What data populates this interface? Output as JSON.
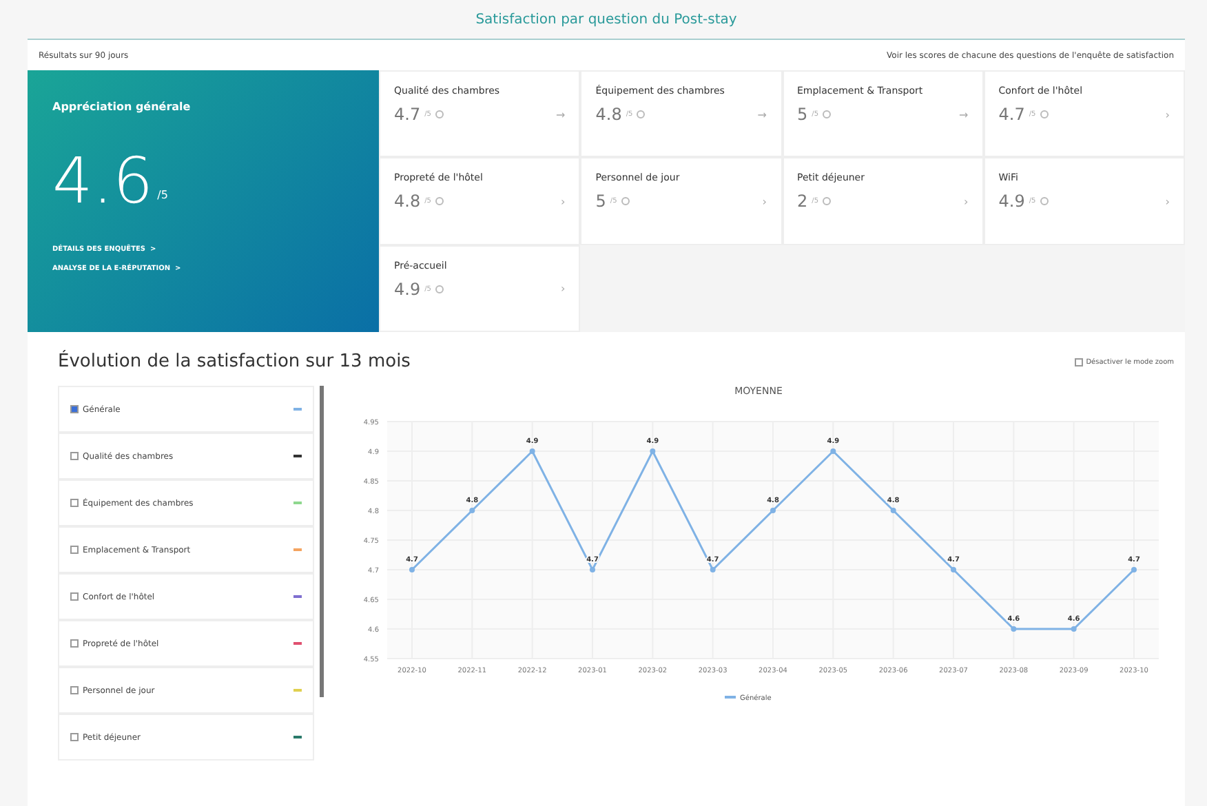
{
  "header": {
    "title": "Satisfaction par question du Post-stay",
    "period": "Résultats sur 90 jours",
    "link": "Voir les scores de chacune des questions de l'enquête de satisfaction"
  },
  "overall": {
    "title": "Appréciation générale",
    "score": "4.6",
    "scale": "/5",
    "links": [
      "DÉTAILS DES ENQUÊTES  >",
      "ANALYSE DE LA E-RÉPUTATION  >"
    ]
  },
  "questions": [
    {
      "label": "Qualité des chambres",
      "score": "4.7",
      "scale": "/5",
      "arrow": "→"
    },
    {
      "label": "Équipement des chambres",
      "score": "4.8",
      "scale": "/5",
      "arrow": "→"
    },
    {
      "label": "Emplacement & Transport",
      "score": "5",
      "scale": "/5",
      "arrow": "→"
    },
    {
      "label": "Confort de l'hôtel",
      "score": "4.7",
      "scale": "/5",
      "arrow": "›"
    },
    {
      "label": "Propreté de l'hôtel",
      "score": "4.8",
      "scale": "/5",
      "arrow": "›"
    },
    {
      "label": "Personnel de jour",
      "score": "5",
      "scale": "/5",
      "arrow": "›"
    },
    {
      "label": "Petit déjeuner",
      "score": "2",
      "scale": "/5",
      "arrow": "›"
    },
    {
      "label": "WiFi",
      "score": "4.9",
      "scale": "/5",
      "arrow": "›"
    },
    {
      "label": "Pré-accueil",
      "score": "4.9",
      "scale": "/5",
      "arrow": "›"
    }
  ],
  "evolution": {
    "title": "Évolution de la satisfaction sur 13 mois",
    "zoom_toggle": {
      "label": "Désactiver le mode zoom",
      "checked": false
    },
    "series_list": [
      {
        "label": "Générale",
        "checked": true,
        "color": "#7fb2e5"
      },
      {
        "label": "Qualité des chambres",
        "checked": false,
        "color": "#333333"
      },
      {
        "label": "Équipement des chambres",
        "checked": false,
        "color": "#8fd88f"
      },
      {
        "label": "Emplacement & Transport",
        "checked": false,
        "color": "#f4a460"
      },
      {
        "label": "Confort de l'hôtel",
        "checked": false,
        "color": "#7f6fd0"
      },
      {
        "label": "Propreté de l'hôtel",
        "checked": false,
        "color": "#e05070"
      },
      {
        "label": "Personnel de jour",
        "checked": false,
        "color": "#e0d050"
      },
      {
        "label": "Petit déjeuner",
        "checked": false,
        "color": "#2a7a6a"
      }
    ],
    "chart_data": {
      "type": "line",
      "title": "MOYENNE",
      "categories": [
        "2022-10",
        "2022-11",
        "2022-12",
        "2023-01",
        "2023-02",
        "2023-03",
        "2023-04",
        "2023-05",
        "2023-06",
        "2023-07",
        "2023-08",
        "2023-09",
        "2023-10"
      ],
      "grid": true,
      "series": [
        {
          "name": "Générale",
          "color": "#7fb2e5",
          "marker": "circle",
          "values": [
            4.7,
            4.8,
            4.9,
            4.7,
            4.9,
            4.7,
            4.8,
            4.9,
            4.8,
            4.7,
            4.6,
            4.6,
            4.7
          ]
        }
      ],
      "ylim": [
        4.55,
        4.95
      ],
      "yticks": [
        4.55,
        4.6,
        4.65,
        4.7,
        4.75,
        4.8,
        4.85,
        4.9,
        4.95
      ],
      "data_labels": true
    }
  }
}
